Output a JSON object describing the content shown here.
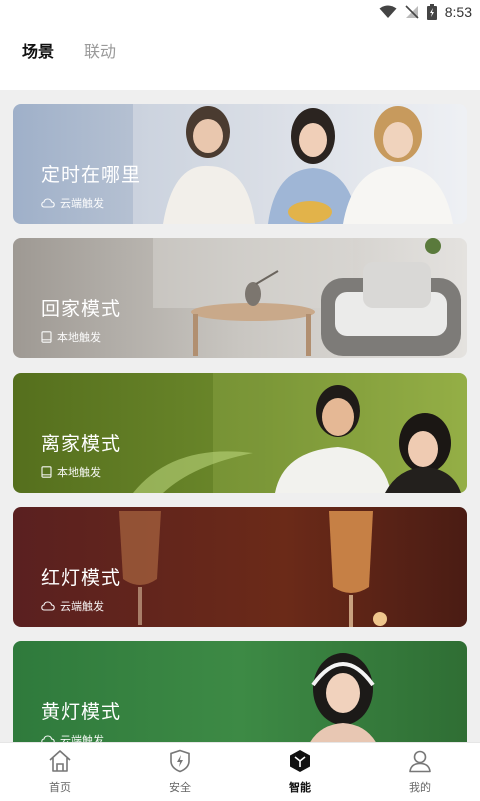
{
  "status_bar": {
    "time": "8:53"
  },
  "tabs": [
    {
      "label": "场景",
      "active": true
    },
    {
      "label": "联动",
      "active": false
    }
  ],
  "scenes": [
    {
      "title": "定时在哪里",
      "trigger": "云端触发",
      "trigger_icon": "cloud-icon"
    },
    {
      "title": "回家模式",
      "trigger": "本地触发",
      "trigger_icon": "tablet-icon"
    },
    {
      "title": "离家模式",
      "trigger": "本地触发",
      "trigger_icon": "tablet-icon"
    },
    {
      "title": "红灯模式",
      "trigger": "云端触发",
      "trigger_icon": "cloud-icon"
    },
    {
      "title": "黄灯模式",
      "trigger": "云端触发",
      "trigger_icon": "cloud-icon"
    }
  ],
  "bottom_nav": [
    {
      "label": "首页",
      "icon": "home-icon",
      "active": false
    },
    {
      "label": "安全",
      "icon": "shield-icon",
      "active": false
    },
    {
      "label": "智能",
      "icon": "cube-icon",
      "active": true
    },
    {
      "label": "我的",
      "icon": "user-icon",
      "active": false
    }
  ],
  "colors": {
    "accent": "#111111",
    "background": "#efefef",
    "inactive_tab": "#9a9a9a"
  }
}
